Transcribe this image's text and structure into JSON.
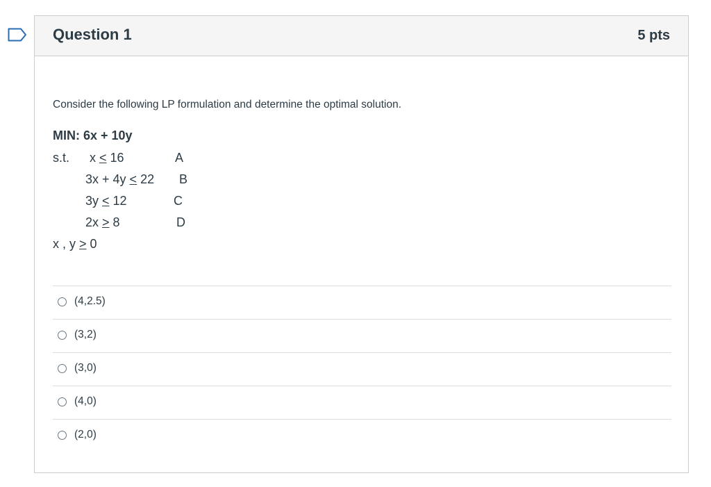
{
  "question": {
    "title": "Question 1",
    "points": "5 pts",
    "prompt": "Consider the following LP formulation and determine the optimal solution.",
    "objective": "MIN: 6x + 10y",
    "constraints": {
      "st_label": "s.t.",
      "a": {
        "lhs": "x ",
        "op": "<",
        "rhs": " 16",
        "tag": "A"
      },
      "b": {
        "lhs": "3x + 4y ",
        "op": "<",
        "rhs": " 22",
        "tag": "B"
      },
      "c": {
        "lhs": "3y ",
        "op": "<",
        "rhs": " 12",
        "tag": "C"
      },
      "d": {
        "lhs": "2x ",
        "op": ">",
        "rhs": " 8",
        "tag": "D"
      },
      "nonneg": {
        "lhs": "x , y ",
        "op": ">",
        "rhs": " 0"
      }
    },
    "answers": [
      {
        "label": "(4,2.5)"
      },
      {
        "label": "(3,2)"
      },
      {
        "label": "(3,0)"
      },
      {
        "label": "(4,0)"
      },
      {
        "label": "(2,0)"
      }
    ]
  },
  "colors": {
    "flag_outline": "#2b6cb0",
    "header_bg": "#f5f5f5",
    "text": "#2d3b45",
    "border": "#c7cdd1"
  }
}
